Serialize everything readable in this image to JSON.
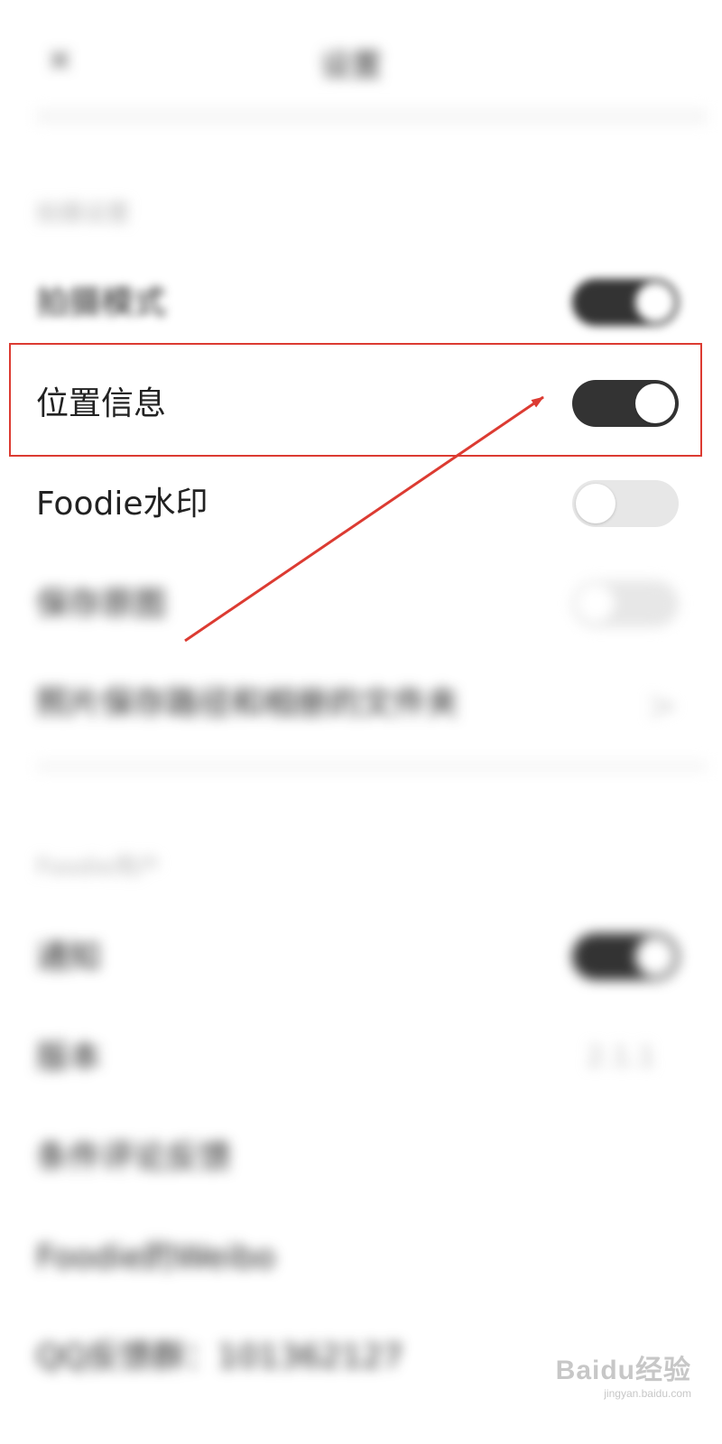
{
  "header": {
    "close_glyph": "×",
    "title": "设置"
  },
  "section1": {
    "label": "拍摄设置",
    "items": [
      {
        "label": "拍摄模式",
        "toggle": "on"
      },
      {
        "label": "位置信息",
        "toggle": "on"
      },
      {
        "label": "Foodie水印",
        "toggle": "off"
      },
      {
        "label": "保存原图",
        "toggle": "off"
      },
      {
        "label": "照片保存路径和相册的文件夹",
        "chevron": ">"
      }
    ]
  },
  "section2": {
    "label": "Foodie用户",
    "items": [
      {
        "label": "通知",
        "toggle": "on"
      },
      {
        "label": "版本",
        "value": "2.1.1"
      },
      {
        "label": "条件评论反馈"
      },
      {
        "label": "Foodie的Weibo"
      },
      {
        "label": "QQ反馈群：101362127"
      }
    ]
  },
  "annotation": {
    "color": "#dc3b32"
  },
  "watermark": {
    "main": "Baidu经验",
    "sub": "jingyan.baidu.com"
  }
}
